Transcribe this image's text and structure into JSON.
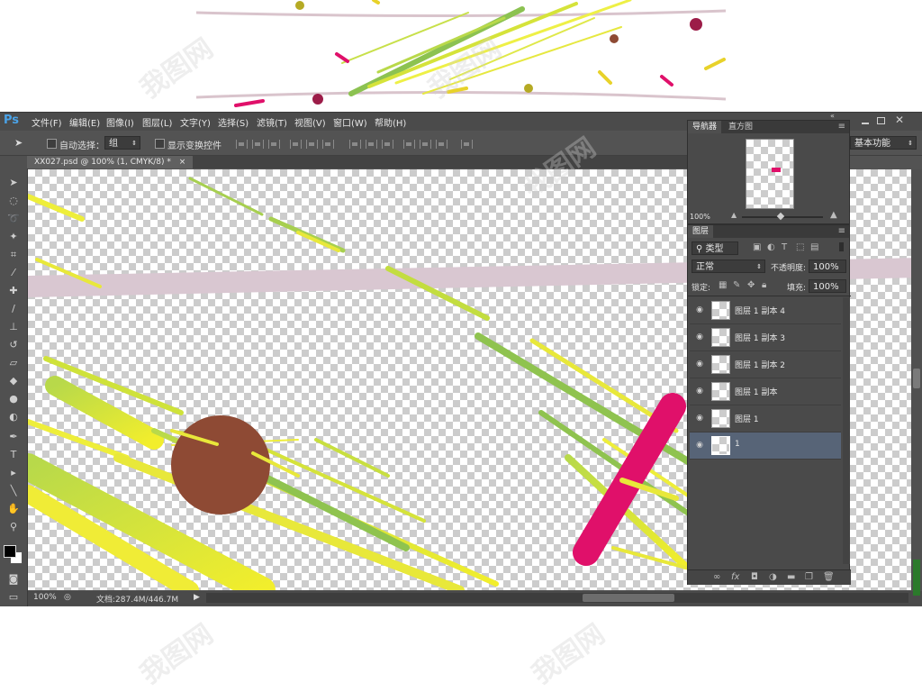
{
  "top_preview": {
    "image_kind": "abstract-artwork-preview"
  },
  "watermark": {
    "text": "我图网"
  },
  "app": {
    "logo": "Ps",
    "menu": [
      "文件(F)",
      "编辑(E)",
      "图像(I)",
      "图层(L)",
      "文字(Y)",
      "选择(S)",
      "滤镜(T)",
      "视图(V)",
      "窗口(W)",
      "帮助(H)"
    ],
    "window_controls": [
      "minimize",
      "restore",
      "close"
    ]
  },
  "options_bar": {
    "auto_select_label": "自动选择：",
    "auto_select_value": "组",
    "show_transform_label": "显示变换控件",
    "workspace": "基本功能"
  },
  "document": {
    "tab_title": "XX027.psd @ 100% (1, CMYK/8) *",
    "close_glyph": "×"
  },
  "status": {
    "zoom": "100%",
    "doc_info": "文档:287.4M/446.7M"
  },
  "navigator_panel": {
    "tabs": [
      "导航器",
      "直方图"
    ],
    "zoom": "100%"
  },
  "layers_panel": {
    "tab": "图层",
    "filter_kind": "类型",
    "blend_mode": "正常",
    "opacity_label": "不透明度:",
    "opacity_value": "100%",
    "lock_label": "锁定:",
    "fill_label": "填充:",
    "fill_value": "100%",
    "layers": [
      {
        "name": "图层 1 副本 4",
        "visible": true,
        "selected": false
      },
      {
        "name": "图层 1 副本 3",
        "visible": true,
        "selected": false
      },
      {
        "name": "图层 1 副本 2",
        "visible": true,
        "selected": false
      },
      {
        "name": "图层 1 副本",
        "visible": true,
        "selected": false
      },
      {
        "name": "图层 1",
        "visible": true,
        "selected": false
      },
      {
        "name": "1",
        "visible": true,
        "selected": true
      }
    ],
    "footer_icons": [
      "link-icon",
      "fx-icon",
      "mask-icon",
      "adjustment-icon",
      "folder-icon",
      "new-layer-icon",
      "trash-icon"
    ]
  },
  "colors": {
    "ui_dark": "#535353",
    "panel": "#4a4a4a",
    "selected_layer": "#576477",
    "accent_magenta": "#e0106a",
    "accent_brown": "#8e4a34",
    "stroke_yellow": "#e8e826",
    "stroke_green": "#8fc34f",
    "pink_band": "#d9c7d1"
  }
}
